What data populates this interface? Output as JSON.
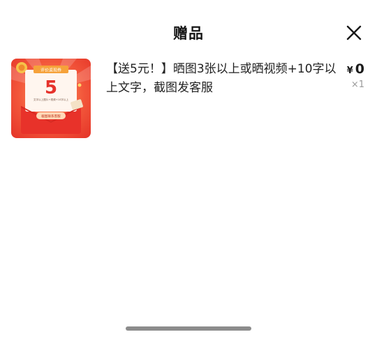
{
  "header": {
    "title": "赠品",
    "close_icon": "close-icon"
  },
  "gift_item": {
    "description": "【送5元！】晒图3张以上或晒视频+10字以上文字，截图发客服",
    "price_symbol": "¥",
    "price_value": "0",
    "quantity": "×1",
    "thumbnail": {
      "badge_text": "评价返现券",
      "amount": "5",
      "small_text": "文字以上图片+视频+10字以上",
      "button_text": "截图联系客服",
      "colors": {
        "background": "#f04a2c",
        "envelope": "#e8322a",
        "badge": "#f6a23a",
        "card": "#fff6ef",
        "number": "#e6322b"
      }
    }
  },
  "colors": {
    "text": "#1a1a1a",
    "muted": "#9a9a9a",
    "home_indicator": "#8c8c8c"
  }
}
